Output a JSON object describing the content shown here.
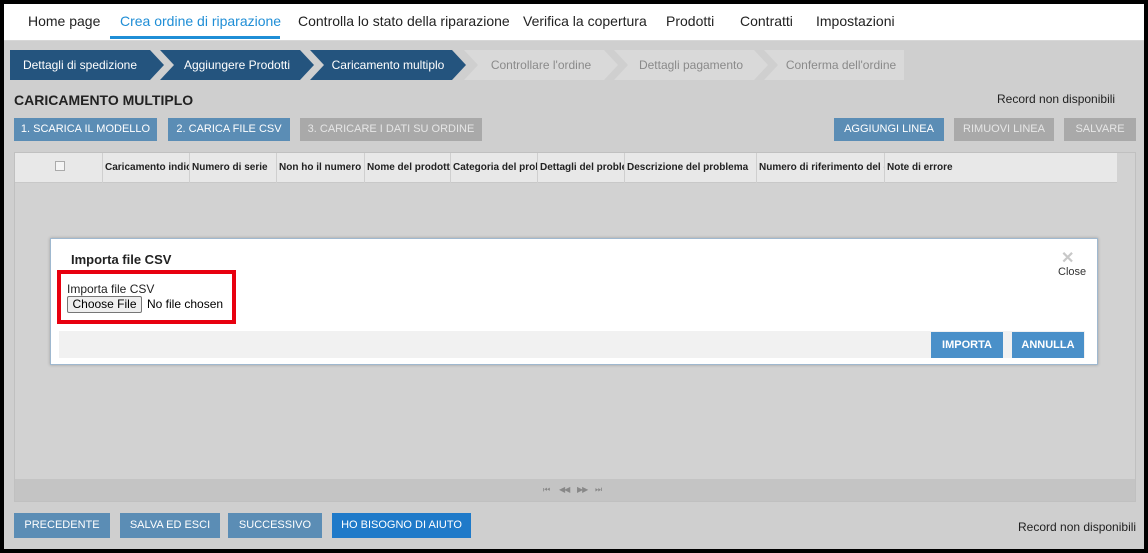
{
  "nav": {
    "items": [
      {
        "label": "Home page",
        "active": false
      },
      {
        "label": "Crea ordine di riparazione",
        "active": true
      },
      {
        "label": "Controlla lo stato della riparazione",
        "active": false
      },
      {
        "label": "Verifica la copertura",
        "active": false
      },
      {
        "label": "Prodotti",
        "active": false
      },
      {
        "label": "Contratti",
        "active": false
      },
      {
        "label": "Impostazioni",
        "active": false
      }
    ]
  },
  "steps": [
    {
      "label": "Dettagli di spedizione",
      "status": "done"
    },
    {
      "label": "Aggiungere Prodotti",
      "status": "done"
    },
    {
      "label": "Caricamento multiplo",
      "status": "current"
    },
    {
      "label": "Controllare l'ordine",
      "status": "todo"
    },
    {
      "label": "Dettagli pagamento",
      "status": "todo"
    },
    {
      "label": "Conferma dell'ordine",
      "status": "todo"
    }
  ],
  "section": {
    "title": "CARICAMENTO MULTIPLO",
    "record_status_top": "Record non disponibili",
    "record_status_bottom": "Record non disponibili"
  },
  "actions": {
    "download_template": "1. SCARICA IL MODELLO",
    "upload_csv": "2. CARICA FILE CSV",
    "load_to_order": "3. CARICARE I DATI SU ORDINE",
    "add_line": "AGGIUNGI LINEA",
    "remove_line": "RIMUOVI LINEA",
    "save": "SALVARE"
  },
  "grid": {
    "columns": [
      "Caricamento indic",
      "Numero di serie",
      "Non ho il numero d",
      "Nome del prodotto",
      "Categoria del prob",
      "Dettagli del proble",
      "Descrizione del problema",
      "Numero di riferimento del cl",
      "Note di errore"
    ],
    "pager_first": "⏮",
    "pager_prev": "◀◀",
    "pager_next": "▶▶",
    "pager_last": "⏭"
  },
  "modal": {
    "title": "Importa file CSV",
    "close_icon": "✕",
    "close_label": "Close",
    "field_label": "Importa file CSV",
    "choose_file": "Choose File",
    "no_file": "No file chosen",
    "import_button": "IMPORTA",
    "cancel_button": "ANNULLA"
  },
  "footer": {
    "previous": "PRECEDENTE",
    "save_exit": "SALVA ED ESCI",
    "next": "SUCCESSIVO",
    "help": "HO BISOGNO DI AIUTO"
  },
  "colors": {
    "accent": "#1f8ed6",
    "step_done": "#24547e",
    "button_blue": "#5b8db5",
    "highlight": "#e8000f"
  }
}
